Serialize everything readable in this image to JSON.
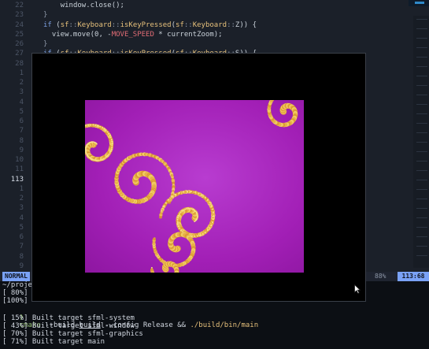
{
  "editor": {
    "gutter": [
      {
        "n": "22",
        "cur": false
      },
      {
        "n": "23",
        "cur": false
      },
      {
        "n": "24",
        "cur": false
      },
      {
        "n": "25",
        "cur": false
      },
      {
        "n": "26",
        "cur": false
      },
      {
        "n": "27",
        "cur": false
      },
      {
        "n": "28",
        "cur": false
      },
      {
        "n": "1",
        "cur": false
      },
      {
        "n": "2",
        "cur": false
      },
      {
        "n": "3",
        "cur": false
      },
      {
        "n": "4",
        "cur": false
      },
      {
        "n": "5",
        "cur": false
      },
      {
        "n": "6",
        "cur": false
      },
      {
        "n": "7",
        "cur": false
      },
      {
        "n": "8",
        "cur": false
      },
      {
        "n": "9",
        "cur": false
      },
      {
        "n": "10",
        "cur": false
      },
      {
        "n": "11",
        "cur": false
      },
      {
        "n": "113",
        "cur": true
      },
      {
        "n": "1",
        "cur": false
      },
      {
        "n": "2",
        "cur": false
      },
      {
        "n": "3",
        "cur": false
      },
      {
        "n": "4",
        "cur": false
      },
      {
        "n": "5",
        "cur": false
      },
      {
        "n": "6",
        "cur": false
      },
      {
        "n": "7",
        "cur": false
      },
      {
        "n": "8",
        "cur": false
      },
      {
        "n": "9",
        "cur": false
      }
    ],
    "code": [
      {
        "indent": "    ",
        "parts": [
          [
            "",
            "window.close();"
          ]
        ]
      },
      {
        "indent": "",
        "parts": [
          [
            "pn",
            "}"
          ]
        ]
      },
      {
        "indent": "",
        "parts": [
          [
            "kw",
            "if"
          ],
          [
            "",
            " ("
          ],
          [
            "ns",
            "sf"
          ],
          [
            "pn",
            "::"
          ],
          [
            "ns",
            "Keyboard"
          ],
          [
            "pn",
            "::"
          ],
          [
            "fn",
            "isKeyPressed"
          ],
          [
            "",
            "("
          ],
          [
            "ns",
            "sf"
          ],
          [
            "pn",
            "::"
          ],
          [
            "ns",
            "Keyboard"
          ],
          [
            "pn",
            "::"
          ],
          [
            "",
            "Z)) {"
          ]
        ]
      },
      {
        "indent": "  ",
        "parts": [
          [
            "",
            "view.move(0, -"
          ],
          [
            "cst",
            "MOVE_SPEED"
          ],
          [
            "",
            " * currentZoom);"
          ]
        ]
      },
      {
        "indent": "",
        "parts": [
          [
            "pn",
            "}"
          ]
        ]
      },
      {
        "indent": "",
        "parts": [
          [
            "kw",
            "if"
          ],
          [
            "",
            " ("
          ],
          [
            "ns",
            "sf"
          ],
          [
            "pn",
            "::"
          ],
          [
            "ns",
            "Keyboard"
          ],
          [
            "pn",
            "::"
          ],
          [
            "fn",
            "isKeyPressed"
          ],
          [
            "",
            "("
          ],
          [
            "ns",
            "sf"
          ],
          [
            "pn",
            "::"
          ],
          [
            "ns",
            "Keyboard"
          ],
          [
            "pn",
            "::"
          ],
          [
            "",
            "S)) {"
          ]
        ]
      }
    ]
  },
  "statusline": {
    "mode": "NORMAL",
    "percent": "88%",
    "position": "113:68"
  },
  "terminal": {
    "lines": [
      {
        "t": "~/proje",
        "cls": ""
      },
      {
        "t": "[ 80%] ",
        "cls": ""
      },
      {
        "t": "[100%] ",
        "cls": ""
      }
    ],
    "prompt": {
      "arrow": "❯",
      "cmd": "cmake",
      "args1": " --build ",
      "underlined": "build",
      "args2": " --config Release && ",
      "path": "./build/bin/main"
    },
    "build": [
      "[ 15%] Built target sfml-system",
      "[ 43%] Built target sfml-window",
      "[ 70%] Built target sfml-graphics",
      "[ 71%] Built target main"
    ]
  },
  "sfml_window": {
    "title": "",
    "colors": {
      "background": "#000000",
      "fractal_base": "#a51fb8",
      "fractal_edge": "#e8b93a"
    }
  }
}
